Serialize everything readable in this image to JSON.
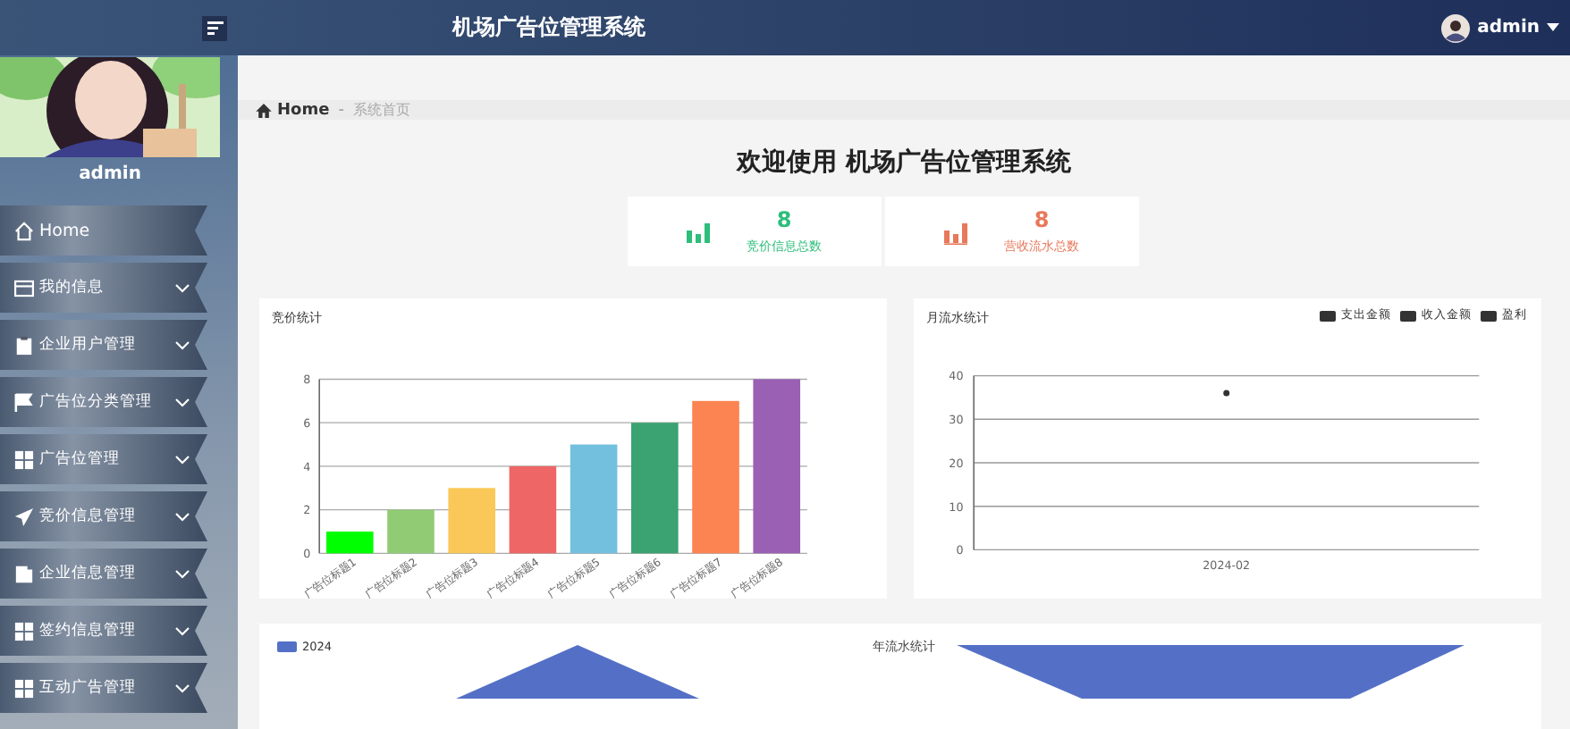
{
  "header": {
    "title": "机场广告位管理系统",
    "user": "admin"
  },
  "sidebar": {
    "user": "admin",
    "items": [
      {
        "label": "Home",
        "expandable": false
      },
      {
        "label": "我的信息",
        "expandable": true
      },
      {
        "label": "企业用户管理",
        "expandable": true
      },
      {
        "label": "广告位分类管理",
        "expandable": true
      },
      {
        "label": "广告位管理",
        "expandable": true
      },
      {
        "label": "竞价信息管理",
        "expandable": true
      },
      {
        "label": "企业信息管理",
        "expandable": true
      },
      {
        "label": "签约信息管理",
        "expandable": true
      },
      {
        "label": "互动广告管理",
        "expandable": true
      }
    ]
  },
  "breadcrumb": {
    "home": "Home",
    "separator": "-",
    "current": "系统首页"
  },
  "welcome": "欢迎使用 机场广告位管理系统",
  "stats": [
    {
      "value": "8",
      "label": "竞价信息总数",
      "color": "#2dbe7a"
    },
    {
      "value": "8",
      "label": "营收流水总数",
      "color": "#e8785a"
    }
  ],
  "bid_chart": {
    "chart_data": {
      "type": "bar",
      "title": "竞价统计",
      "categories": [
        "广告位标题1",
        "广告位标题2",
        "广告位标题3",
        "广告位标题4",
        "广告位标题5",
        "广告位标题6",
        "广告位标题7",
        "广告位标题8"
      ],
      "values": [
        1,
        2,
        3,
        4,
        5,
        6,
        7,
        8
      ],
      "colors": [
        "#00ff00",
        "#91cc75",
        "#fac858",
        "#ee6666",
        "#73c0de",
        "#3ba272",
        "#fc8452",
        "#9a60b4"
      ],
      "ylim": [
        0,
        8
      ],
      "yticks": [
        0,
        2,
        4,
        6,
        8
      ],
      "grid": true
    }
  },
  "monthly_chart": {
    "chart_data": {
      "type": "line",
      "title": "月流水统计",
      "x": [
        "2024-02"
      ],
      "series": [
        {
          "name": "支出金额",
          "color": "#333333",
          "values": [
            null
          ]
        },
        {
          "name": "收入金额",
          "color": "#333333",
          "values": [
            null
          ]
        },
        {
          "name": "盈利",
          "color": "#333333",
          "values": [
            36
          ],
          "marker": true
        }
      ],
      "ylim": [
        0,
        40
      ],
      "yticks": [
        0,
        10,
        20,
        30,
        40
      ],
      "grid": true
    }
  },
  "annual_chart": {
    "title": "年流水统计",
    "legend": [
      "2024"
    ]
  }
}
